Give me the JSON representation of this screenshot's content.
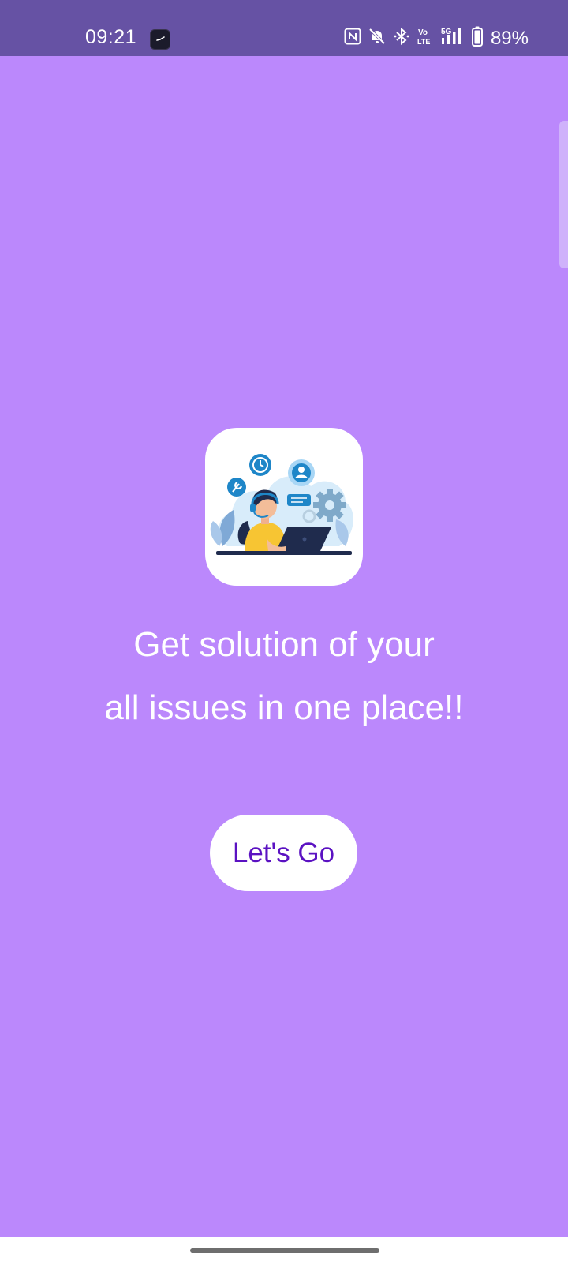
{
  "status_bar": {
    "time": "09:21",
    "battery": "89%",
    "icons": [
      "clock-app-icon",
      "nfc-icon",
      "bell-off-icon",
      "bluetooth-icon",
      "volte-icon",
      "5g-signal-icon",
      "battery-icon"
    ]
  },
  "hero": {
    "image": "customer-support-illustration",
    "line1": "Get solution of your",
    "line2": "all issues in one place!!"
  },
  "cta": {
    "label": "Let's Go"
  },
  "colors": {
    "background": "#bb88fc",
    "status_bar": "#6652a4",
    "button_text": "#5b12c2",
    "card": "#ffffff"
  }
}
